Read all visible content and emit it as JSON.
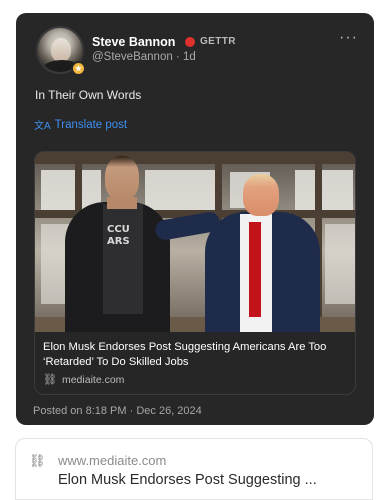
{
  "author": {
    "name": "Steve Bannon",
    "platform": "GETTR",
    "handle": "@SteveBannon · 1d"
  },
  "post": {
    "text": "In Their Own Words",
    "translate_label": "Translate post",
    "posted_at": "Posted on 8:18 PM · Dec 26, 2024"
  },
  "link_card": {
    "title": "Elon Musk Endorses Post Suggesting Americans Are Too ‘Retarded’ To Do Skilled Jobs",
    "domain": "mediaite.com",
    "shirt_text": "CCU ARS"
  },
  "bottom_card": {
    "domain": "www.mediaite.com",
    "title": "Elon Musk Endorses Post Suggesting ..."
  },
  "colors": {
    "card_bg": "#272727",
    "link_blue": "#3d8ff0",
    "verified_red": "#e0322d",
    "badge_gold": "#f2b53c"
  }
}
